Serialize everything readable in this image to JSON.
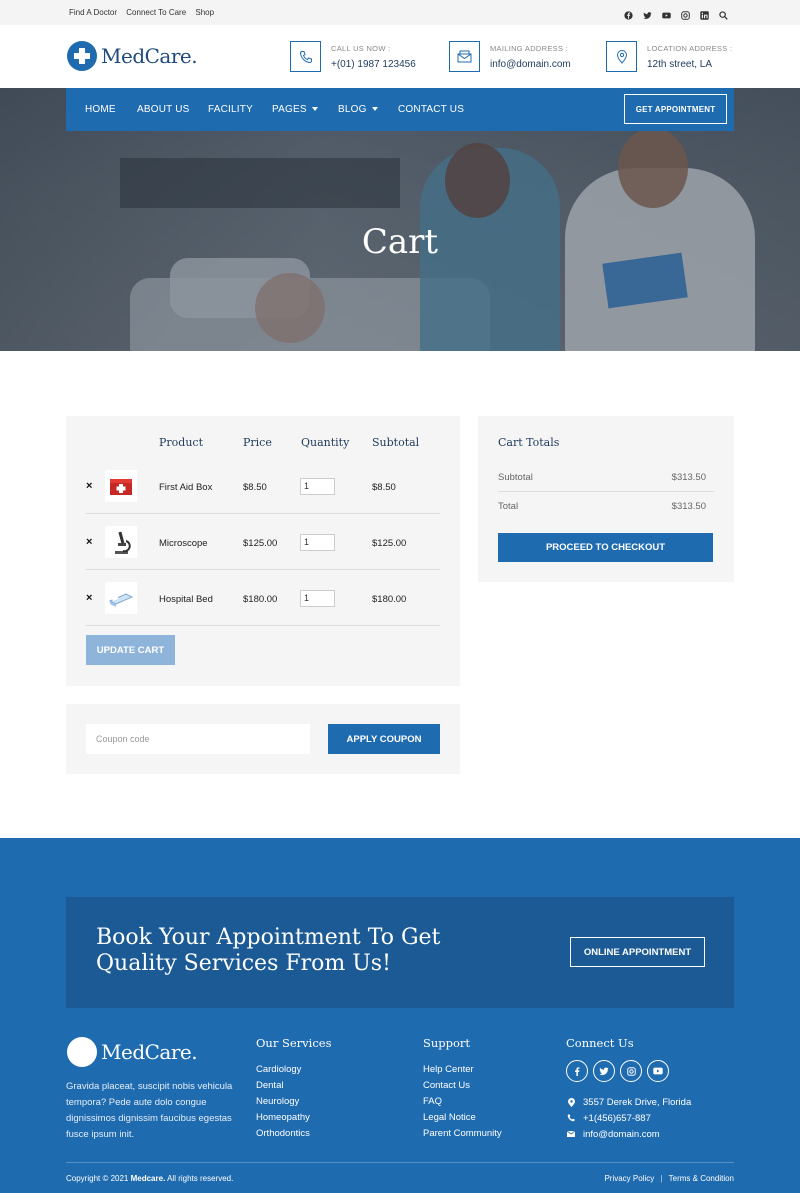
{
  "topbar": {
    "links": [
      "Find A Doctor",
      "Connect To Care",
      "Shop"
    ],
    "social_icons": [
      "facebook-icon",
      "twitter-icon",
      "youtube-icon",
      "instagram-icon",
      "linkedin-icon",
      "search-icon"
    ]
  },
  "brand": {
    "name": "MedCare."
  },
  "header": {
    "call": {
      "label": "CALL US NOW :",
      "value": "+(01) 1987 123456"
    },
    "mail": {
      "label": "MAILING ADDRESS :",
      "value": "info@domain.com"
    },
    "location": {
      "label": "LOCATION ADDRESS :",
      "value": "12th street, LA"
    }
  },
  "nav": {
    "items": [
      "HOME",
      "ABOUT US",
      "FACILITY",
      "PAGES",
      "BLOG",
      "CONTACT US"
    ],
    "appointment": "GET APPOINTMENT"
  },
  "hero": {
    "title": "Cart"
  },
  "cart": {
    "headers": [
      "Product",
      "Price",
      "Quantity",
      "Subtotal"
    ],
    "remove_symbol": "×",
    "items": [
      {
        "name": "First Aid Box",
        "price": "$8.50",
        "qty": "1",
        "subtotal": "$8.50",
        "icon": "first-aid-box-icon"
      },
      {
        "name": "Microscope",
        "price": "$125.00",
        "qty": "1",
        "subtotal": "$125.00",
        "icon": "microscope-icon"
      },
      {
        "name": "Hospital Bed",
        "price": "$180.00",
        "qty": "1",
        "subtotal": "$180.00",
        "icon": "hospital-bed-icon"
      }
    ],
    "update": "UPDATE CART"
  },
  "coupon": {
    "placeholder": "Coupon code",
    "button": "APPLY COUPON"
  },
  "totals": {
    "title": "Cart Totals",
    "subtotal_label": "Subtotal",
    "subtotal": "$313.50",
    "total_label": "Total",
    "total": "$313.50",
    "checkout": "PROCEED TO CHECKOUT"
  },
  "footer": {
    "cta_title": "Book Your Appointment To Get Quality Services From Us!",
    "cta_button": "ONLINE APPOINTMENT",
    "about": "Gravida placeat, suscipit nobis vehicula tempora? Pede aute dolo congue dignissimos dignissim faucibus egestas fusce ipsum init.",
    "services_title": "Our Services",
    "services": [
      "Cardiology",
      "Dental",
      "Neurology",
      "Homeopathy",
      "Orthodontics"
    ],
    "support_title": "Support",
    "support": [
      "Help Center",
      "Contact Us",
      "FAQ",
      "Legal Notice",
      "Parent Community"
    ],
    "connect_title": "Connect Us",
    "address": "3557 Derek Drive, Florida",
    "phone": "+1(456)657-887",
    "email": "info@domain.com",
    "copyright_prefix": "Copyright © 2021 ",
    "copyright_brand": "Medcare.",
    "copyright_suffix": " All rights reserved.",
    "privacy": "Privacy Policy",
    "terms": "Terms & Condition"
  },
  "colors": {
    "primary": "#1f6bb0",
    "dark": "#1b5a95",
    "update_button": "#8fb4da"
  }
}
